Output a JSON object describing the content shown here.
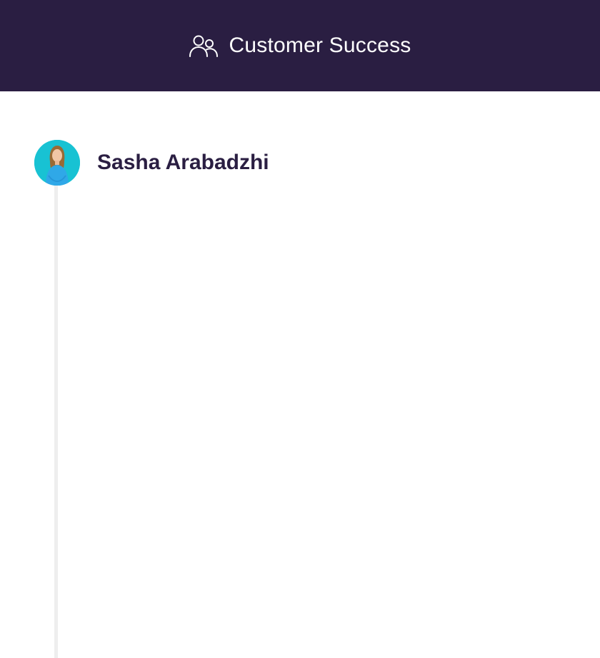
{
  "header": {
    "title": "Customer Success",
    "icon": "users-icon",
    "background": "#2a1e42"
  },
  "timeline": {
    "person": {
      "name": "Sasha Arabadzhi",
      "avatar_icon": "avatar-photo"
    }
  },
  "colors": {
    "accent": "#2a1e42",
    "avatar_bg": "#18c2d3",
    "timeline_line": "#eeeeee"
  }
}
